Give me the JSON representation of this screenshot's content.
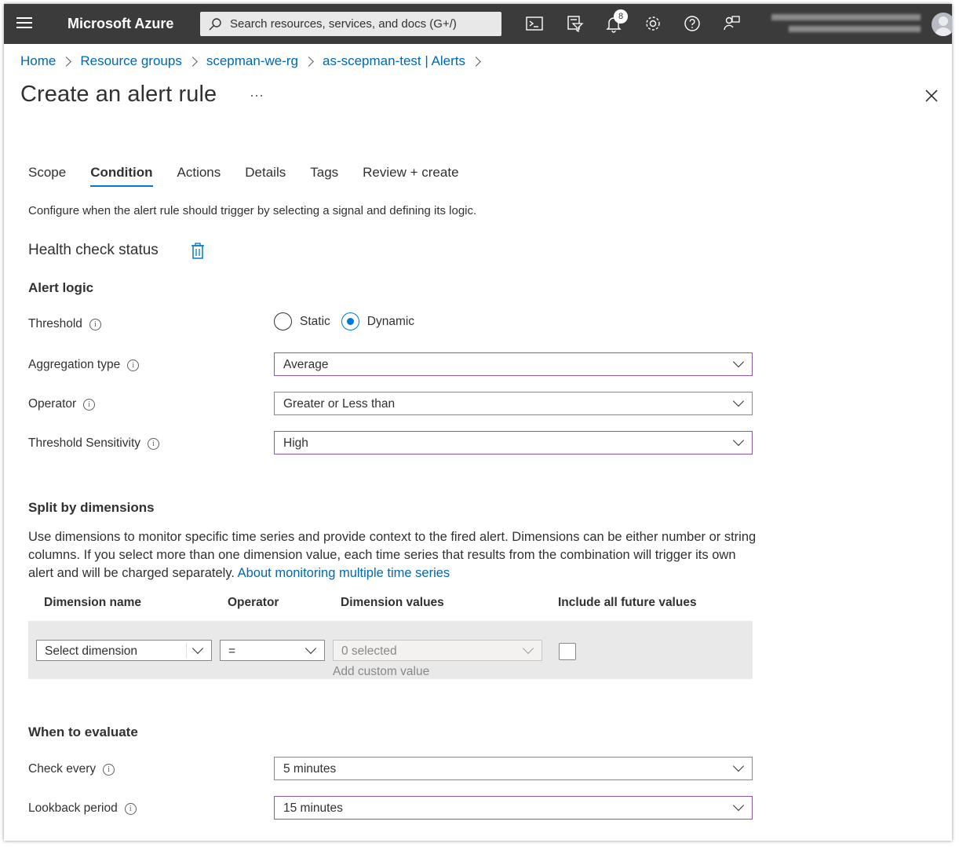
{
  "topbar": {
    "brand": "Microsoft Azure",
    "search_placeholder": "Search resources, services, and docs (G+/)",
    "notification_count": "8",
    "icons": [
      "cloud-shell-icon",
      "directory-filter-icon",
      "bell-icon",
      "gear-icon",
      "help-icon",
      "feedback-icon"
    ]
  },
  "breadcrumb": [
    "Home",
    "Resource groups",
    "scepman-we-rg",
    "as-scepman-test | Alerts"
  ],
  "page": {
    "title": "Create an alert rule",
    "more": "···"
  },
  "tabs": [
    {
      "label": "Scope",
      "active": false
    },
    {
      "label": "Condition",
      "active": true
    },
    {
      "label": "Actions",
      "active": false
    },
    {
      "label": "Details",
      "active": false
    },
    {
      "label": "Tags",
      "active": false
    },
    {
      "label": "Review + create",
      "active": false
    }
  ],
  "description": "Configure when the alert rule should trigger by selecting a signal and defining its logic.",
  "signal_name": "Health check status",
  "alert_logic": {
    "heading": "Alert logic",
    "threshold_label": "Threshold",
    "threshold_options": [
      "Static",
      "Dynamic"
    ],
    "threshold_selected": "Dynamic",
    "aggregation_label": "Aggregation type",
    "aggregation_value": "Average",
    "operator_label": "Operator",
    "operator_value": "Greater or Less than",
    "sensitivity_label": "Threshold Sensitivity",
    "sensitivity_value": "High"
  },
  "split": {
    "heading": "Split by dimensions",
    "description": "Use dimensions to monitor specific time series and provide context to the fired alert. Dimensions can be either number or string columns. If you select more than one dimension value, each time series that results from the combination will trigger its own alert and will be charged separately.",
    "link": "About monitoring multiple time series",
    "columns": [
      "Dimension name",
      "Operator",
      "Dimension values",
      "Include all future values"
    ],
    "row": {
      "dimension_placeholder": "Select dimension",
      "operator": "=",
      "values": "0 selected",
      "custom_value": "Add custom value"
    }
  },
  "evaluate": {
    "heading": "When to evaluate",
    "check_every_label": "Check every",
    "check_every_value": "5 minutes",
    "lookback_label": "Lookback period",
    "lookback_value": "15 minutes"
  },
  "colors": {
    "topbar": "#3b3b3b",
    "link": "#0067b8",
    "accent": "#0078d4",
    "focus_border": "#8d57b0"
  }
}
